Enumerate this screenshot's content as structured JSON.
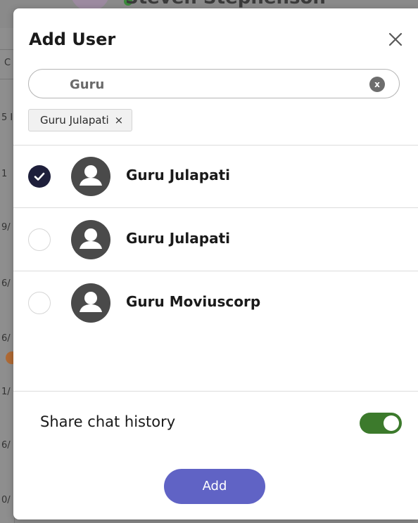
{
  "background": {
    "header_name": "Steven Stephenson",
    "left_fragments": [
      "C",
      "5 I",
      "1",
      "9/",
      "6/",
      "6/",
      "1/",
      "6/",
      "0/"
    ]
  },
  "modal": {
    "title": "Add User",
    "close_icon": "close-icon",
    "search": {
      "value": "Guru",
      "clear_label": "x"
    },
    "selected_chips": [
      {
        "label": "Guru Julapati",
        "remove_icon": "×"
      }
    ],
    "results": [
      {
        "name": "Guru Julapati",
        "selected": true
      },
      {
        "name": "Guru Julapati",
        "selected": false
      },
      {
        "name": "Guru Moviuscorp",
        "selected": false
      }
    ],
    "share_history": {
      "label": "Share chat history",
      "enabled": true
    },
    "add_button": "Add"
  },
  "colors": {
    "accent": "#6063c5",
    "toggle_on": "#3c7a2c",
    "checked_radio": "#1e1f3b",
    "avatar": "#4a4a4a"
  }
}
